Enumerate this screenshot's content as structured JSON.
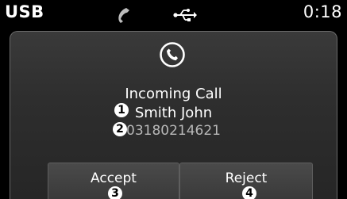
{
  "status_bar": {
    "source": "USB",
    "clock": "0:18",
    "phone_icon": "phone-handset-icon",
    "usb_icon": "usb-icon"
  },
  "call": {
    "icon": "phone-circle-icon",
    "title": "Incoming Call",
    "caller_name": "Smith John",
    "caller_number": "03180214621"
  },
  "buttons": {
    "accept_label": "Accept",
    "reject_label": "Reject"
  },
  "callouts": {
    "c1": "1",
    "c2": "2",
    "c3": "3",
    "c4": "4"
  },
  "colors": {
    "background": "#000000",
    "panel": "#2e2e2e",
    "text": "#ffffff",
    "number_text": "#b8b8b8"
  }
}
